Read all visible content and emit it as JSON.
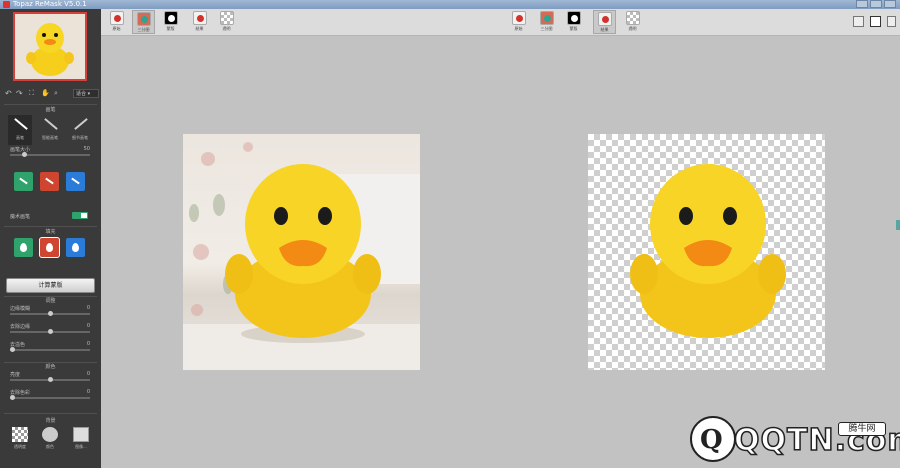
{
  "window": {
    "title": "Topaz ReMask V5.0.1"
  },
  "sidebar": {
    "zoom_label": "适合",
    "section_brush": "画笔",
    "tools": [
      {
        "label": "画笔"
      },
      {
        "label": "智能画笔"
      },
      {
        "label": "细节画笔"
      }
    ],
    "brush_size": {
      "label": "画笔大小",
      "value": "50"
    },
    "auto_label": "魔术画笔",
    "section_fill": "填充",
    "refine_button": "计算蒙版",
    "section_adjust": "调整",
    "sliders_adjust": [
      {
        "label": "边缘模糊",
        "value": "0"
      },
      {
        "label": "去除边缘",
        "value": "0"
      },
      {
        "label": "去溢色",
        "value": "0"
      }
    ],
    "section_color": "颜色",
    "sliders_color": [
      {
        "label": "亮度",
        "value": "0"
      },
      {
        "label": "去除色彩",
        "value": "0"
      }
    ],
    "section_bg": "背景",
    "bg_options": [
      {
        "label": "透明度"
      },
      {
        "label": "颜色"
      },
      {
        "label": "图像..."
      }
    ]
  },
  "view_left": [
    {
      "label": "原始",
      "icon": "apple-icon"
    },
    {
      "label": "三分图",
      "icon": "colorize-icon"
    },
    {
      "label": "蒙版",
      "icon": "mask-icon"
    },
    {
      "label": "结果",
      "icon": "apple-icon"
    },
    {
      "label": "透明",
      "icon": "transparency-icon"
    }
  ],
  "view_right": [
    {
      "label": "原始",
      "icon": "apple-icon"
    },
    {
      "label": "三分图",
      "icon": "colorize-icon"
    },
    {
      "label": "蒙版",
      "icon": "mask-icon"
    },
    {
      "label": "结果",
      "icon": "apple-icon"
    },
    {
      "label": "透明",
      "icon": "transparency-icon"
    }
  ],
  "watermark": {
    "logo": "Q",
    "text": "QQTN.com",
    "tag": "腾牛网"
  },
  "colors": {
    "accent_green": "#2fa36b",
    "accent_red": "#cf4530",
    "accent_blue": "#2b7bd8",
    "duck_yellow": "#f6cf1c"
  }
}
